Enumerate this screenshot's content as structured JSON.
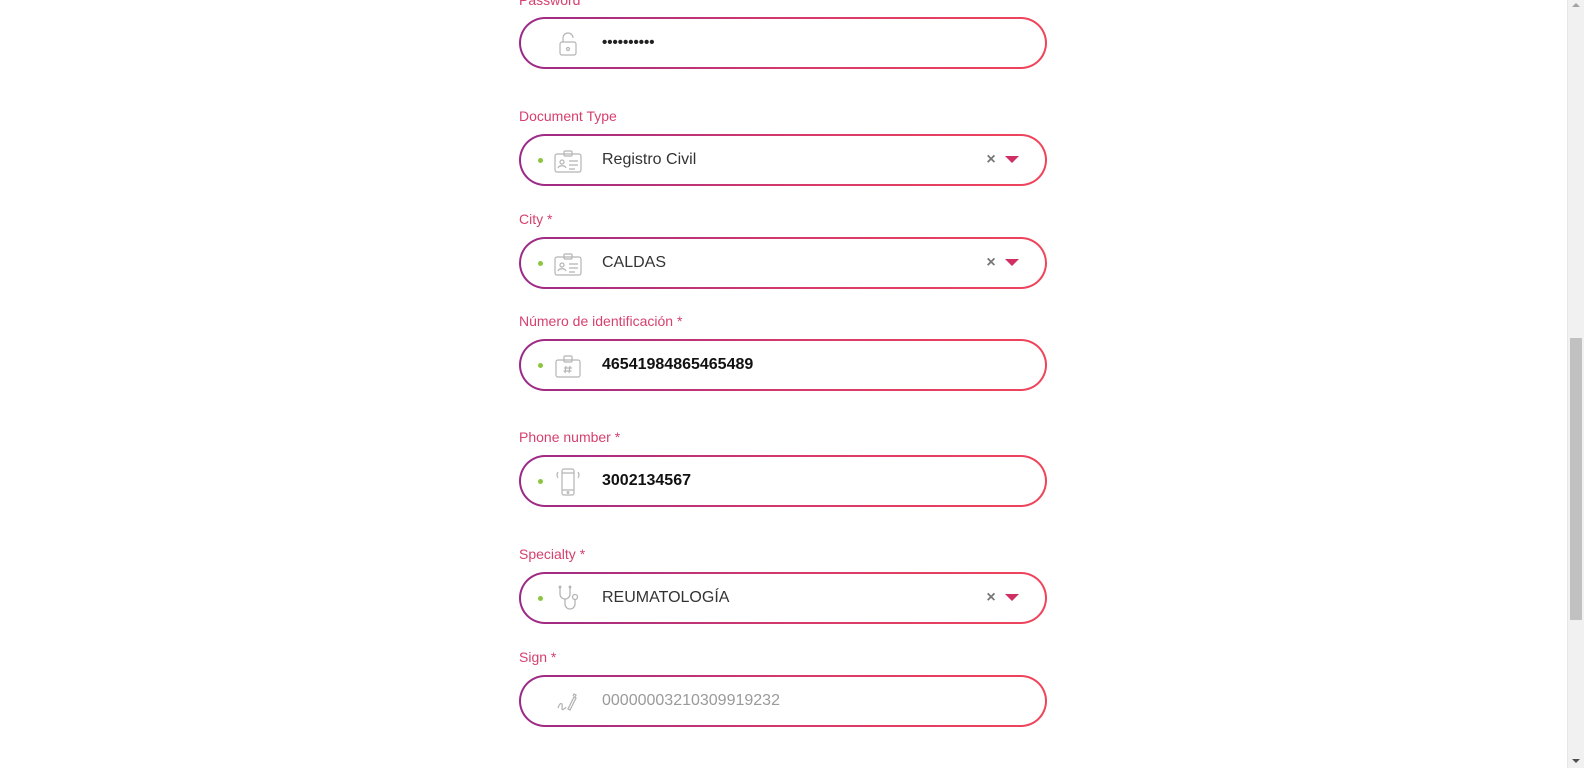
{
  "form": {
    "password": {
      "label": "Password",
      "value": "••••••••••",
      "icon": "lock-icon"
    },
    "document_type": {
      "label": "Document Type",
      "value": "Registro Civil",
      "icon": "id-card-icon",
      "clear": "×"
    },
    "city": {
      "label": "City *",
      "value": "CALDAS",
      "icon": "id-card-icon",
      "clear": "×"
    },
    "id_number": {
      "label": "Número de identificación *",
      "value": "46541984865465489",
      "icon": "id-badge-icon"
    },
    "phone": {
      "label": "Phone number *",
      "value": "3002134567",
      "icon": "mobile-phone-icon"
    },
    "specialty": {
      "label": "Specialty *",
      "value": "REUMATOLOGÍA",
      "icon": "stethoscope-icon",
      "clear": "×"
    },
    "sign": {
      "label": "Sign *",
      "placeholder": "00000003210309919232",
      "icon": "signature-icon"
    }
  },
  "colors": {
    "label": "#d6406f",
    "border_start": "#9b2a86",
    "border_end": "#f0445a",
    "valid_dot": "#8cc63f",
    "caret": "#cf2f63"
  }
}
